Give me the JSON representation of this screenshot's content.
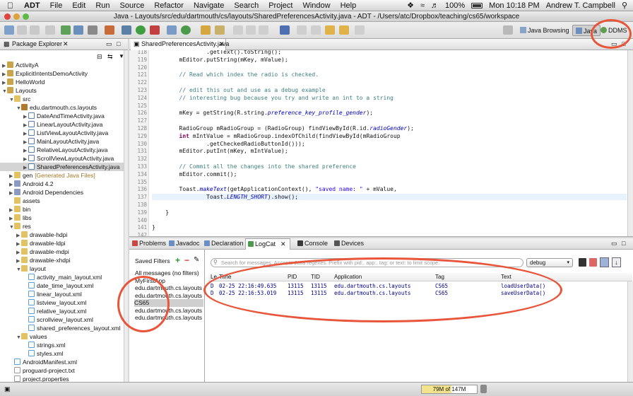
{
  "menubar": {
    "app_name": "ADT",
    "items": [
      "File",
      "Edit",
      "Run",
      "Source",
      "Refactor",
      "Navigate",
      "Search",
      "Project",
      "Window",
      "Help"
    ],
    "battery": "100%",
    "clock": "Mon 10:18 PM",
    "user": "Andrew T. Campbell"
  },
  "window": {
    "title": "Java - Layouts/src/edu/dartmouth/cs/layouts/SharedPreferencesActivity.java - ADT - /Users/atc/Dropbox/teaching/cs65/workspace"
  },
  "perspectives": {
    "java_browsing": "Java Browsing",
    "java": "Java",
    "ddms": "DDMS"
  },
  "package_explorer": {
    "tab_label": "Package Explorer",
    "tree": [
      {
        "depth": 0,
        "toggle": "▶",
        "icon": "proj",
        "label": "ActivityA"
      },
      {
        "depth": 0,
        "toggle": "▶",
        "icon": "proj",
        "label": "ExplicitIntentsDemoActivity"
      },
      {
        "depth": 0,
        "toggle": "▶",
        "icon": "proj",
        "label": "HelloWorld"
      },
      {
        "depth": 0,
        "toggle": "▼",
        "icon": "proj",
        "label": "Layouts"
      },
      {
        "depth": 1,
        "toggle": "▼",
        "icon": "fold",
        "label": "src"
      },
      {
        "depth": 2,
        "toggle": "▼",
        "icon": "pkg",
        "label": "edu.dartmouth.cs.layouts"
      },
      {
        "depth": 3,
        "toggle": "▶",
        "icon": "java",
        "label": "DateAndTimeActivity.java"
      },
      {
        "depth": 3,
        "toggle": "▶",
        "icon": "java",
        "label": "LinearLayoutActivity.java"
      },
      {
        "depth": 3,
        "toggle": "▶",
        "icon": "java",
        "label": "ListViewLayoutActivity.java"
      },
      {
        "depth": 3,
        "toggle": "▶",
        "icon": "java",
        "label": "MainLayoutActivity.java"
      },
      {
        "depth": 3,
        "toggle": "▶",
        "icon": "java",
        "label": "RelativeLayoutActivity.java"
      },
      {
        "depth": 3,
        "toggle": "▶",
        "icon": "java",
        "label": "ScrollViewLayoutActivity.java"
      },
      {
        "depth": 3,
        "toggle": "▶",
        "icon": "java",
        "label": "SharedPreferencesActivity.java",
        "selected": true
      },
      {
        "depth": 1,
        "toggle": "▶",
        "icon": "fold",
        "label": "gen",
        "suffix": "[Generated Java Files]"
      },
      {
        "depth": 1,
        "toggle": "▶",
        "icon": "lib",
        "label": "Android 4.2"
      },
      {
        "depth": 1,
        "toggle": "▶",
        "icon": "lib",
        "label": "Android Dependencies"
      },
      {
        "depth": 1,
        "toggle": "",
        "icon": "fold",
        "label": "assets"
      },
      {
        "depth": 1,
        "toggle": "▶",
        "icon": "fold",
        "label": "bin"
      },
      {
        "depth": 1,
        "toggle": "▶",
        "icon": "fold",
        "label": "libs"
      },
      {
        "depth": 1,
        "toggle": "▼",
        "icon": "fold",
        "label": "res"
      },
      {
        "depth": 2,
        "toggle": "▶",
        "icon": "fold",
        "label": "drawable-hdpi"
      },
      {
        "depth": 2,
        "toggle": "▶",
        "icon": "fold",
        "label": "drawable-ldpi"
      },
      {
        "depth": 2,
        "toggle": "▶",
        "icon": "fold",
        "label": "drawable-mdpi"
      },
      {
        "depth": 2,
        "toggle": "▶",
        "icon": "fold",
        "label": "drawable-xhdpi"
      },
      {
        "depth": 2,
        "toggle": "▼",
        "icon": "fold",
        "label": "layout"
      },
      {
        "depth": 3,
        "toggle": "",
        "icon": "xml",
        "label": "activity_main_layout.xml"
      },
      {
        "depth": 3,
        "toggle": "",
        "icon": "xml",
        "label": "date_time_layout.xml"
      },
      {
        "depth": 3,
        "toggle": "",
        "icon": "xml",
        "label": "linear_layout.xml"
      },
      {
        "depth": 3,
        "toggle": "",
        "icon": "xml",
        "label": "listview_layout.xml"
      },
      {
        "depth": 3,
        "toggle": "",
        "icon": "xml",
        "label": "relative_layout.xml"
      },
      {
        "depth": 3,
        "toggle": "",
        "icon": "xml",
        "label": "scrollview_layout.xml"
      },
      {
        "depth": 3,
        "toggle": "",
        "icon": "xml",
        "label": "shared_preferences_layout.xml"
      },
      {
        "depth": 2,
        "toggle": "▼",
        "icon": "fold",
        "label": "values"
      },
      {
        "depth": 3,
        "toggle": "",
        "icon": "xml",
        "label": "strings.xml"
      },
      {
        "depth": 3,
        "toggle": "",
        "icon": "xml",
        "label": "styles.xml"
      },
      {
        "depth": 1,
        "toggle": "",
        "icon": "xml",
        "label": "AndroidManifest.xml"
      },
      {
        "depth": 1,
        "toggle": "",
        "icon": "file",
        "label": "proguard-project.txt"
      },
      {
        "depth": 1,
        "toggle": "",
        "icon": "file",
        "label": "project.properties"
      }
    ]
  },
  "editor": {
    "tab_label": "SharedPreferencesActivity.java",
    "lines": [
      {
        "n": "118",
        "segs": [
          [
            "",
            "                .getText().toString();"
          ]
        ]
      },
      {
        "n": "119",
        "segs": [
          [
            "",
            "        mEditor.putString(mKey, mValue);"
          ]
        ]
      },
      {
        "n": "120",
        "segs": [
          [
            "",
            ""
          ]
        ]
      },
      {
        "n": "121",
        "segs": [
          [
            "cmt",
            "        // Read which index the radio is checked."
          ]
        ]
      },
      {
        "n": "122",
        "segs": [
          [
            "",
            ""
          ]
        ]
      },
      {
        "n": "123",
        "segs": [
          [
            "cmt",
            "        // edit this out and use as a debug example"
          ]
        ]
      },
      {
        "n": "124",
        "segs": [
          [
            "cmt",
            "        // interesting bug because you try and write an int to a string"
          ]
        ]
      },
      {
        "n": "125",
        "segs": [
          [
            "",
            ""
          ]
        ]
      },
      {
        "n": "126",
        "segs": [
          [
            "",
            "        mKey = getString(R.string."
          ],
          [
            "fld",
            "preference_key_profile_gender"
          ],
          [
            "",
            ");"
          ]
        ]
      },
      {
        "n": "127",
        "segs": [
          [
            "",
            ""
          ]
        ]
      },
      {
        "n": "128",
        "segs": [
          [
            "",
            "        RadioGroup mRadioGroup = (RadioGroup) findViewById(R.id."
          ],
          [
            "fld",
            "radioGender"
          ],
          [
            "",
            ");"
          ]
        ]
      },
      {
        "n": "129",
        "segs": [
          [
            "kw",
            "        int"
          ],
          [
            "",
            " mIntValue = mRadioGroup.indexOfChild(findViewById(mRadioGroup"
          ]
        ]
      },
      {
        "n": "130",
        "segs": [
          [
            "",
            "                .getCheckedRadioButtonId()));"
          ]
        ]
      },
      {
        "n": "131",
        "segs": [
          [
            "",
            "        mEditor.putInt(mKey, mIntValue);"
          ]
        ]
      },
      {
        "n": "132",
        "segs": [
          [
            "",
            ""
          ]
        ]
      },
      {
        "n": "133",
        "segs": [
          [
            "cmt",
            "        // Commit all the changes into the shared preference"
          ]
        ]
      },
      {
        "n": "134",
        "segs": [
          [
            "",
            "        mEditor.commit();"
          ]
        ]
      },
      {
        "n": "135",
        "segs": [
          [
            "",
            ""
          ]
        ]
      },
      {
        "n": "136",
        "segs": [
          [
            "",
            "        Toast."
          ],
          [
            "fld",
            "makeText"
          ],
          [
            "",
            "(getApplicationContext(), "
          ],
          [
            "str",
            "\"saved name: \""
          ],
          [
            "",
            " + mValue,"
          ]
        ]
      },
      {
        "n": "137",
        "segs": [
          [
            "",
            "                Toast."
          ],
          [
            "fld",
            "LENGTH_SHORT"
          ],
          [
            "",
            ").show();"
          ]
        ],
        "highlight": true
      },
      {
        "n": "138",
        "segs": [
          [
            "",
            ""
          ]
        ]
      },
      {
        "n": "139",
        "segs": [
          [
            "",
            "    }"
          ]
        ]
      },
      {
        "n": "140",
        "segs": [
          [
            "",
            ""
          ]
        ]
      },
      {
        "n": "141",
        "segs": [
          [
            "",
            "}"
          ]
        ]
      },
      {
        "n": "142",
        "segs": [
          [
            "",
            ""
          ]
        ]
      }
    ]
  },
  "bottom_tabs": [
    "Problems",
    "Javadoc",
    "Declaration",
    "LogCat",
    "Console",
    "Devices"
  ],
  "logcat": {
    "saved_filters_label": "Saved Filters",
    "filters": [
      "All messages (no filters)",
      "MyFirstApp",
      "edu.dartmouth.cs.layouts",
      "edu.dartmouth.cs.layouts",
      "CS65",
      "edu.dartmouth.cs.layouts",
      "edu.dartmouth.cs.layouts"
    ],
    "selected_filter_index": 4,
    "search_placeholder": "Search for messages. Accepts Java regexes. Prefix with pid:, app:, tag: or text: to limit scope.",
    "level": "debug",
    "columns": [
      "Le",
      "Time",
      "PID",
      "TID",
      "Application",
      "Tag",
      "Text"
    ],
    "rows": [
      {
        "level": "D",
        "time": "02-25 22:16:49.635",
        "pid": "13115",
        "tid": "13115",
        "app": "edu.dartmouth.cs.layouts",
        "tag": "CS65",
        "text": "loadUserData()"
      },
      {
        "level": "D",
        "time": "02-25 22:16:53.019",
        "pid": "13115",
        "tid": "13115",
        "app": "edu.dartmouth.cs.layouts",
        "tag": "CS65",
        "text": "saveUserData()"
      }
    ]
  },
  "status": {
    "heap_used": "79M",
    "heap_of": "of",
    "heap_total": "147M",
    "heap_fraction": 0.54
  },
  "colors": {
    "annotation_red": "#e8553a",
    "comment": "#3f7f7f",
    "keyword": "#7f0055",
    "string": "#2a00ff",
    "field": "#0000c0",
    "log_debug": "#00008b"
  }
}
